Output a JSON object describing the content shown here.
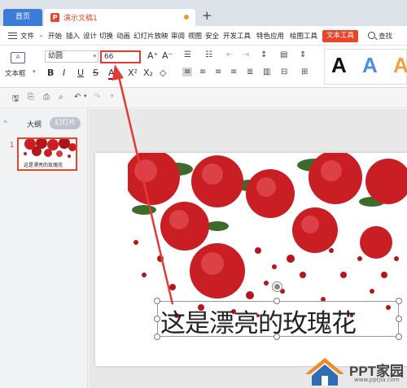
{
  "tabs": {
    "home": "首页",
    "doc_title": "演示文稿1",
    "plus": "+"
  },
  "menu": {
    "file": "文件",
    "items": [
      "开始",
      "插入",
      "设计",
      "切换",
      "动画",
      "幻灯片放映",
      "审阅",
      "视图",
      "安全",
      "开发工具",
      "特色应用",
      "绘图工具"
    ],
    "active": "文本工具",
    "search": "查找"
  },
  "ribbon": {
    "textbox_label": "文本框",
    "font_name": "幼圆",
    "font_size": "66",
    "grow": "A⁺",
    "shrink": "A⁻",
    "style_letter": "A"
  },
  "panel": {
    "outline": "大纲",
    "slides": "幻灯片",
    "slide_number": "1",
    "thumb_caption": "这是漂亮的玫瑰花"
  },
  "slide": {
    "text": "这是漂亮的玫瑰花"
  },
  "watermark": {
    "title": "PPT家园",
    "url": "www.pptjia.com"
  },
  "colors": {
    "accent": "#e8452a",
    "highlight": "#e53935",
    "rose": "#c81e24"
  }
}
